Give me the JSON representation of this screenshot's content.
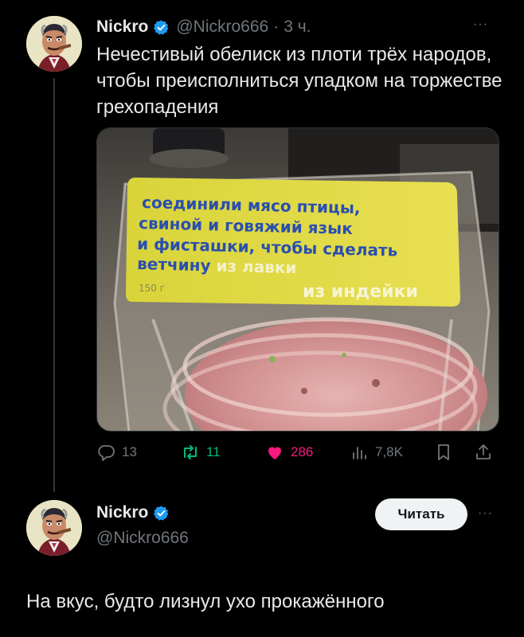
{
  "tweet": {
    "author_name": "Nickro",
    "handle": "@Nickro666",
    "separator": "·",
    "time": "3 ч.",
    "text": "Нечестивый обелиск из плоти трёх народов, чтобы преисполниться упадком на торжестве грехопадения",
    "media": {
      "label_lines": [
        "соединили мясо птицы,",
        "свиной и говяжий язык",
        "и фисташки, чтобы сделать"
      ],
      "label_last_prefix": "ветчину ",
      "label_last_brand": "из лавки",
      "weight": "150 г",
      "variant": "из индейки"
    },
    "stats": {
      "replies": "13",
      "reposts": "11",
      "likes": "286",
      "views": "7,8K"
    },
    "colors": {
      "like": "#f91880",
      "repost": "#00ba7c",
      "verified": "#1d9bf0"
    }
  },
  "reply": {
    "author_name": "Nickro",
    "handle": "@Nickro666",
    "follow_label": "Читать",
    "text": "На вкус, будто лизнул ухо прокажённого"
  }
}
